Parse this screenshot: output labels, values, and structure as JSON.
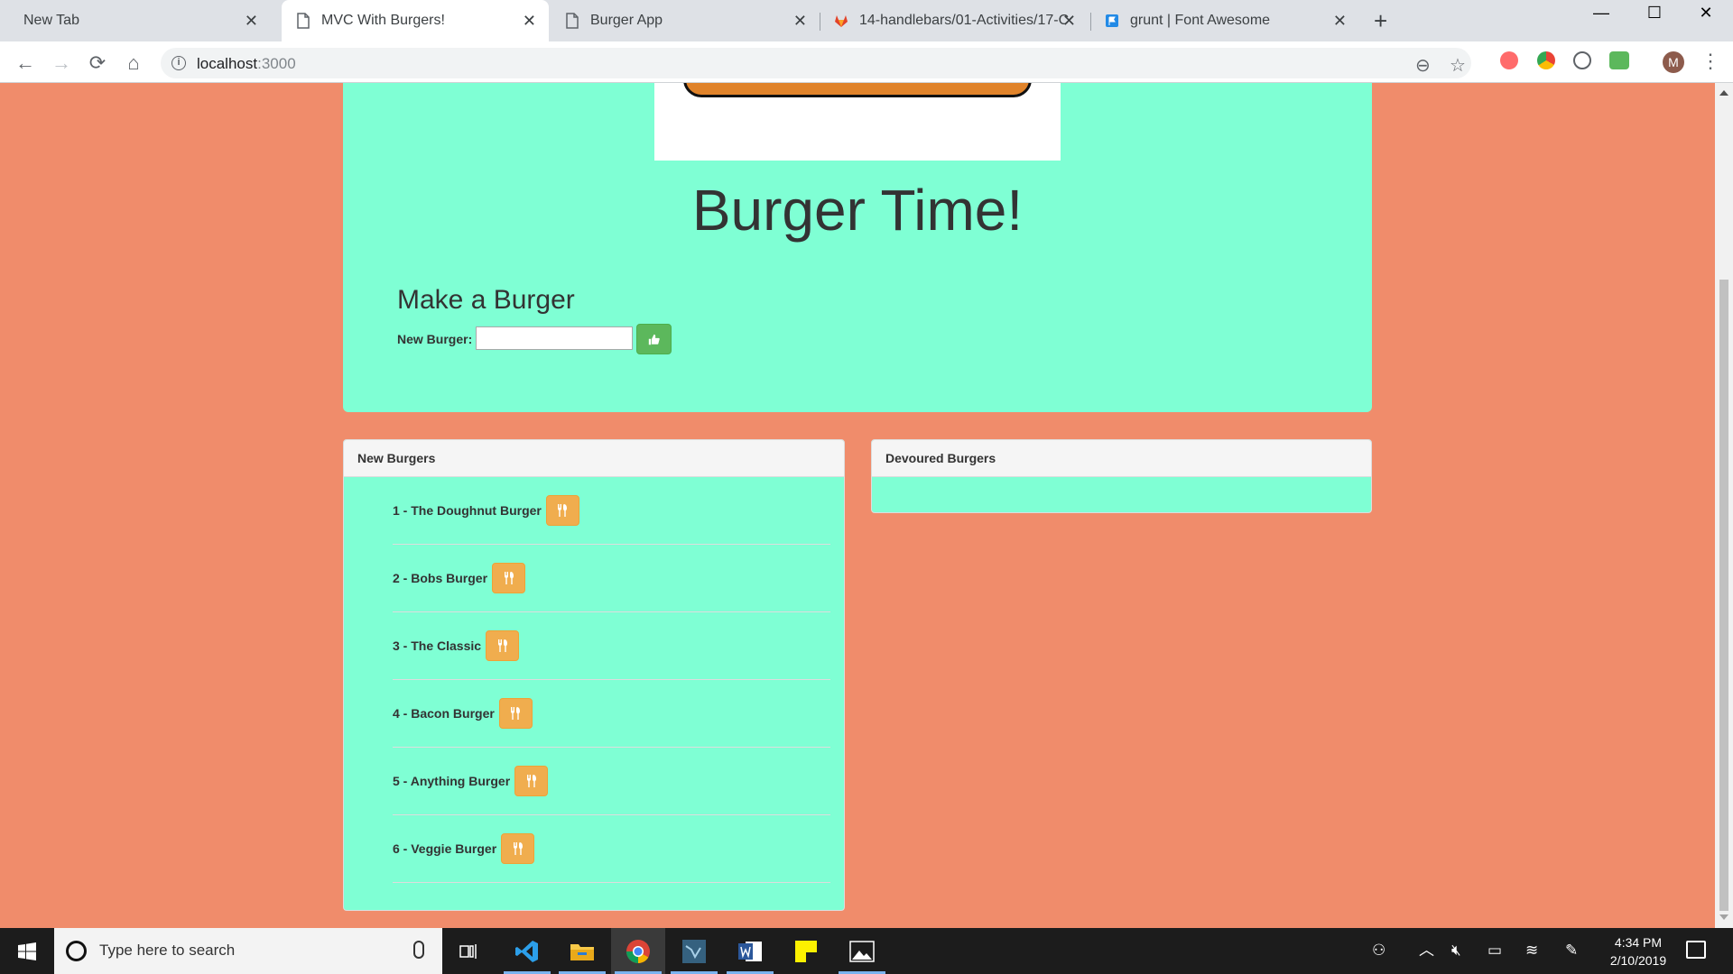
{
  "browser": {
    "tabs": [
      {
        "title": "New Tab",
        "icon": "none"
      },
      {
        "title": "MVC With Burgers!",
        "icon": "page-icon"
      },
      {
        "title": "Burger App",
        "icon": "page-icon"
      },
      {
        "title": "14-handlebars/01-Activities/17-C",
        "icon": "gitlab-icon"
      },
      {
        "title": "grunt | Font Awesome",
        "icon": "font-awesome-flag-icon"
      }
    ],
    "active_tab_index": 1,
    "url_host": "localhost",
    "url_port": ":3000",
    "profile_initial": "M",
    "extensions": [
      "screencast-icon",
      "chrome-sync-icon",
      "ublock-icon",
      "cors-icon"
    ]
  },
  "page": {
    "title": "Burger Time!",
    "form": {
      "heading": "Make a Burger",
      "label": "New Burger:",
      "input_value": "",
      "submit_icon": "thumbs-up-icon"
    },
    "new_burgers": {
      "heading": "New Burgers",
      "items": [
        "1 - The Doughnut Burger",
        "2 - Bobs Burger",
        "3 - The Classic",
        "4 - Bacon Burger",
        "5 - Anything Burger",
        "6 - Veggie Burger"
      ],
      "item_button_icon": "utensils-icon"
    },
    "devoured_burgers": {
      "heading": "Devoured Burgers",
      "items": []
    },
    "colors": {
      "background": "#f08c6b",
      "panel": "#7fffd4",
      "submit_button": "#5cb85c",
      "devour_button": "#f0ad4e"
    }
  },
  "taskbar": {
    "search_placeholder": "Type here to search",
    "time": "4:34 PM",
    "date": "2/10/2019",
    "apps": [
      "task-view-icon",
      "vscode-icon",
      "file-explorer-icon",
      "chrome-icon",
      "mysql-workbench-icon",
      "word-icon",
      "sticky-notes-icon",
      "photos-icon"
    ]
  }
}
